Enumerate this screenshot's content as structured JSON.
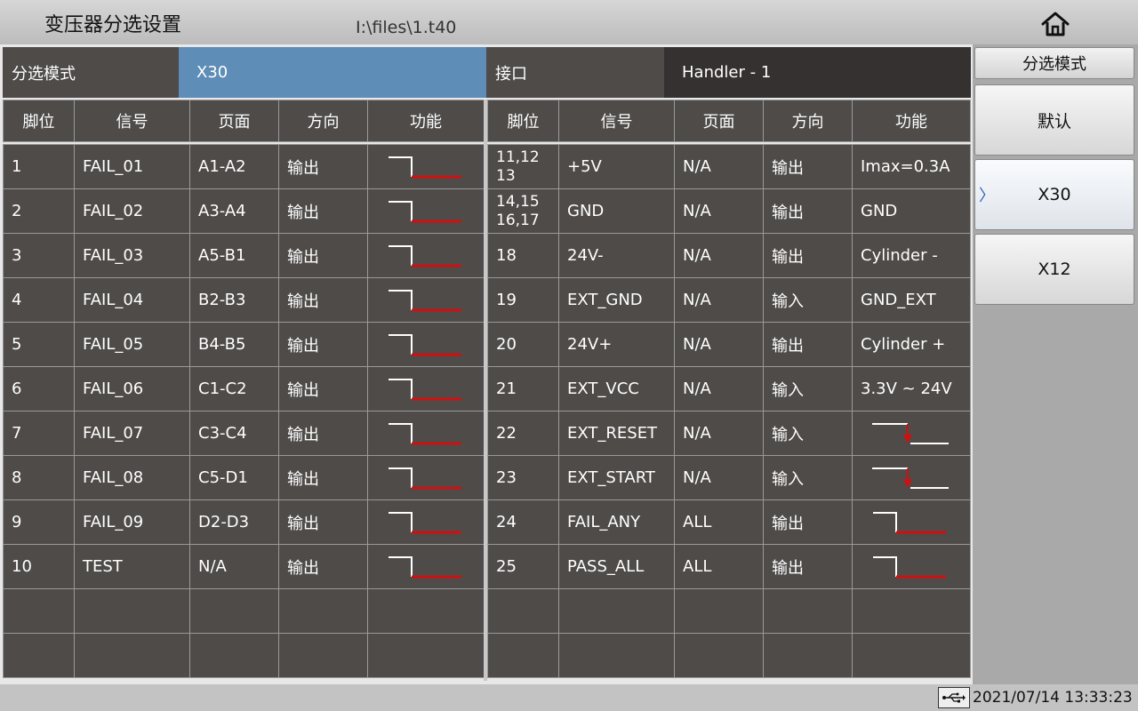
{
  "header": {
    "title": "变压器分选设置",
    "file_path": "I:\\files\\1.t40"
  },
  "mode_row": {
    "mode_label": "分选模式",
    "mode_value": "X30",
    "interface_label": "接口",
    "interface_value": "Handler - 1"
  },
  "columns": {
    "left": [
      "脚位",
      "信号",
      "页面",
      "方向",
      "功能"
    ],
    "right": [
      "脚位",
      "信号",
      "页面",
      "方向",
      "功能"
    ]
  },
  "left_rows": [
    {
      "pin": "1",
      "signal": "FAIL_01",
      "page": "A1-A2",
      "dir": "输出",
      "func_icon": "falling-edge-red"
    },
    {
      "pin": "2",
      "signal": "FAIL_02",
      "page": "A3-A4",
      "dir": "输出",
      "func_icon": "falling-edge-red"
    },
    {
      "pin": "3",
      "signal": "FAIL_03",
      "page": "A5-B1",
      "dir": "输出",
      "func_icon": "falling-edge-red"
    },
    {
      "pin": "4",
      "signal": "FAIL_04",
      "page": "B2-B3",
      "dir": "输出",
      "func_icon": "falling-edge-red"
    },
    {
      "pin": "5",
      "signal": "FAIL_05",
      "page": "B4-B5",
      "dir": "输出",
      "func_icon": "falling-edge-red"
    },
    {
      "pin": "6",
      "signal": "FAIL_06",
      "page": "C1-C2",
      "dir": "输出",
      "func_icon": "falling-edge-red"
    },
    {
      "pin": "7",
      "signal": "FAIL_07",
      "page": "C3-C4",
      "dir": "输出",
      "func_icon": "falling-edge-red"
    },
    {
      "pin": "8",
      "signal": "FAIL_08",
      "page": "C5-D1",
      "dir": "输出",
      "func_icon": "falling-edge-red"
    },
    {
      "pin": "9",
      "signal": "FAIL_09",
      "page": "D2-D3",
      "dir": "输出",
      "func_icon": "falling-edge-red"
    },
    {
      "pin": "10",
      "signal": "TEST",
      "page": "N/A",
      "dir": "输出",
      "func_icon": "falling-edge-red"
    },
    {
      "pin": "",
      "signal": "",
      "page": "",
      "dir": "",
      "func_icon": ""
    },
    {
      "pin": "",
      "signal": "",
      "page": "",
      "dir": "",
      "func_icon": ""
    }
  ],
  "right_rows": [
    {
      "pin": "11,12\n13",
      "signal": "+5V",
      "page": "N/A",
      "dir": "输出",
      "func": "Imax=0.3A",
      "func_icon": ""
    },
    {
      "pin": "14,15\n16,17",
      "signal": "GND",
      "page": "N/A",
      "dir": "输出",
      "func": "GND",
      "func_icon": ""
    },
    {
      "pin": "18",
      "signal": "24V-",
      "page": "N/A",
      "dir": "输出",
      "func": "Cylinder -",
      "func_icon": ""
    },
    {
      "pin": "19",
      "signal": "EXT_GND",
      "page": "N/A",
      "dir": "输入",
      "func": "GND_EXT",
      "func_icon": ""
    },
    {
      "pin": "20",
      "signal": "24V+",
      "page": "N/A",
      "dir": "输出",
      "func": "Cylinder +",
      "func_icon": ""
    },
    {
      "pin": "21",
      "signal": "EXT_VCC",
      "page": "N/A",
      "dir": "输入",
      "func": "3.3V ~ 24V",
      "func_icon": ""
    },
    {
      "pin": "22",
      "signal": "EXT_RESET",
      "page": "N/A",
      "dir": "输入",
      "func": "",
      "func_icon": "falling-edge-trigger"
    },
    {
      "pin": "23",
      "signal": "EXT_START",
      "page": "N/A",
      "dir": "输入",
      "func": "",
      "func_icon": "falling-edge-trigger"
    },
    {
      "pin": "24",
      "signal": "FAIL_ANY",
      "page": "ALL",
      "dir": "输出",
      "func": "",
      "func_icon": "falling-edge-red"
    },
    {
      "pin": "25",
      "signal": "PASS_ALL",
      "page": "ALL",
      "dir": "输出",
      "func": "",
      "func_icon": "falling-edge-red"
    },
    {
      "pin": "",
      "signal": "",
      "page": "",
      "dir": "",
      "func": "",
      "func_icon": ""
    },
    {
      "pin": "",
      "signal": "",
      "page": "",
      "dir": "",
      "func": "",
      "func_icon": ""
    }
  ],
  "sidebar": {
    "title": "分选模式",
    "buttons": [
      {
        "label": "默认",
        "selected": false
      },
      {
        "label": "X30",
        "selected": true
      },
      {
        "label": "X12",
        "selected": false
      }
    ]
  },
  "footer": {
    "datetime": "2021/07/14 13:33:23",
    "usb_icon": "usb-icon"
  },
  "colors": {
    "mode_value_bg": "#5e8db7",
    "cell_bg": "#4e4b49",
    "wave_red": "#d01010"
  }
}
